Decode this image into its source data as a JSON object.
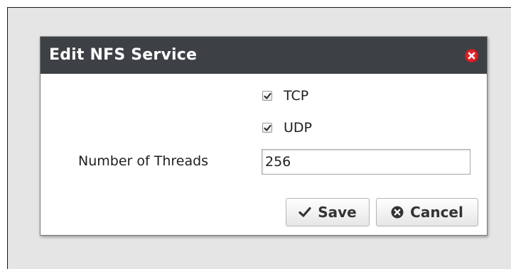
{
  "dialog": {
    "title": "Edit NFS Service",
    "close_icon": "close-circle-icon",
    "title_bar_color": "#3d4045",
    "close_color": "#e0262b"
  },
  "protocols": {
    "tcp": {
      "label": "TCP",
      "checked": true
    },
    "udp": {
      "label": "UDP",
      "checked": true
    }
  },
  "threads": {
    "label": "Number of Threads",
    "value": "256"
  },
  "buttons": {
    "save_label": "Save",
    "save_icon": "checkmark-icon",
    "cancel_label": "Cancel",
    "cancel_icon": "cancel-circle-icon"
  }
}
